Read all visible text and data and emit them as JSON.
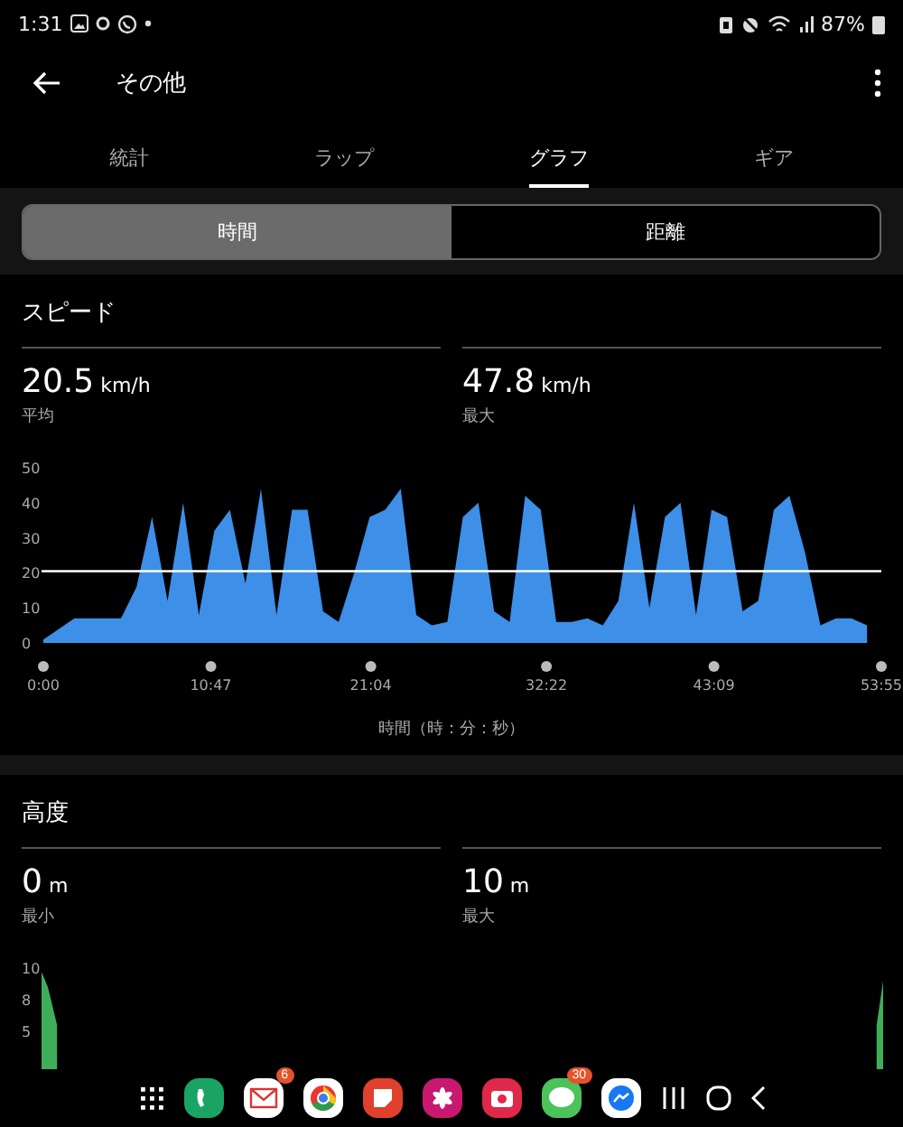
{
  "status_bar": {
    "time": "1:31",
    "battery": "87%"
  },
  "app_bar": {
    "title": "その他"
  },
  "tabs": [
    {
      "label": "統計",
      "selected": false
    },
    {
      "label": "ラップ",
      "selected": false
    },
    {
      "label": "グラフ",
      "selected": true
    },
    {
      "label": "ギア",
      "selected": false
    }
  ],
  "segments": [
    {
      "label": "時間",
      "selected": true
    },
    {
      "label": "距離",
      "selected": false
    }
  ],
  "sections": [
    {
      "title": "スピード",
      "stats": [
        {
          "value": "20.5",
          "unit": "km/h",
          "label": "平均"
        },
        {
          "value": "47.8",
          "unit": "km/h",
          "label": "最大"
        }
      ],
      "chart_data": {
        "type": "area",
        "xlabel": "時間（時：分：秒）",
        "xlim": [
          0,
          53.92
        ],
        "ylim": [
          0,
          50
        ],
        "x": [
          0,
          1,
          2,
          3,
          4,
          5,
          6,
          7,
          8,
          9,
          10,
          11,
          12,
          13,
          14,
          15,
          16,
          17,
          18,
          19,
          20,
          21,
          22,
          23,
          24,
          25,
          26,
          27,
          28,
          29,
          30,
          31,
          32,
          33,
          34,
          35,
          36,
          37,
          38,
          39,
          40,
          41,
          42,
          43,
          44,
          45,
          46,
          47,
          48,
          49,
          50,
          51,
          52,
          53
        ],
        "series": [
          {
            "color": "#3d8fe8",
            "values": [
              1,
              4,
              7,
              7,
              7,
              7,
              16,
              36,
              12,
              40,
              8,
              32,
              38,
              17,
              44,
              8,
              38,
              38,
              9,
              6,
              20,
              36,
              38,
              44,
              8,
              5,
              6,
              36,
              40,
              9,
              6,
              42,
              38,
              6,
              6,
              7,
              5,
              12,
              40,
              10,
              36,
              40,
              8,
              38,
              36,
              9,
              12,
              38,
              42,
              26,
              5,
              7,
              7,
              5
            ]
          }
        ],
        "xticks": [
          {
            "value": 0,
            "label": "0:00"
          },
          {
            "value": 10.78,
            "label": "10:47"
          },
          {
            "value": 21.07,
            "label": "21:04"
          },
          {
            "value": 32.37,
            "label": "32:22"
          },
          {
            "value": 43.15,
            "label": "43:09"
          },
          {
            "value": 53.92,
            "label": "53:55"
          }
        ],
        "yticks": [
          0,
          10,
          20,
          30,
          40,
          50
        ]
      },
      "average_line": true
    },
    {
      "title": "高度",
      "stats": [
        {
          "value": "0",
          "unit": "m",
          "label": "最小"
        },
        {
          "value": "10",
          "unit": "m",
          "label": "最大"
        }
      ],
      "chart_data": {
        "type": "area",
        "xlim": [
          0,
          53.92
        ],
        "ylim": [
          0,
          10
        ],
        "x": [
          0,
          0.4,
          1.0,
          27,
          53.5,
          53.92
        ],
        "series": [
          {
            "color": "#3fae5a",
            "values": [
              9.7,
              8.5,
              5.5,
              null,
              5.5,
              9
            ]
          }
        ],
        "yticks": [
          {
            "value": 5,
            "label": "5"
          },
          {
            "value": 7.5,
            "label": "8"
          },
          {
            "value": 10,
            "label": "10"
          }
        ]
      }
    }
  ],
  "dock": [
    {
      "kind": "apps"
    },
    {
      "kind": "phone"
    },
    {
      "kind": "mail",
      "badge": "6"
    },
    {
      "kind": "browser"
    },
    {
      "kind": "notes"
    },
    {
      "kind": "flower"
    },
    {
      "kind": "camera"
    },
    {
      "kind": "chat",
      "badge": "30"
    },
    {
      "kind": "messenger"
    },
    {
      "kind": "recents"
    },
    {
      "kind": "home"
    },
    {
      "kind": "back"
    }
  ]
}
